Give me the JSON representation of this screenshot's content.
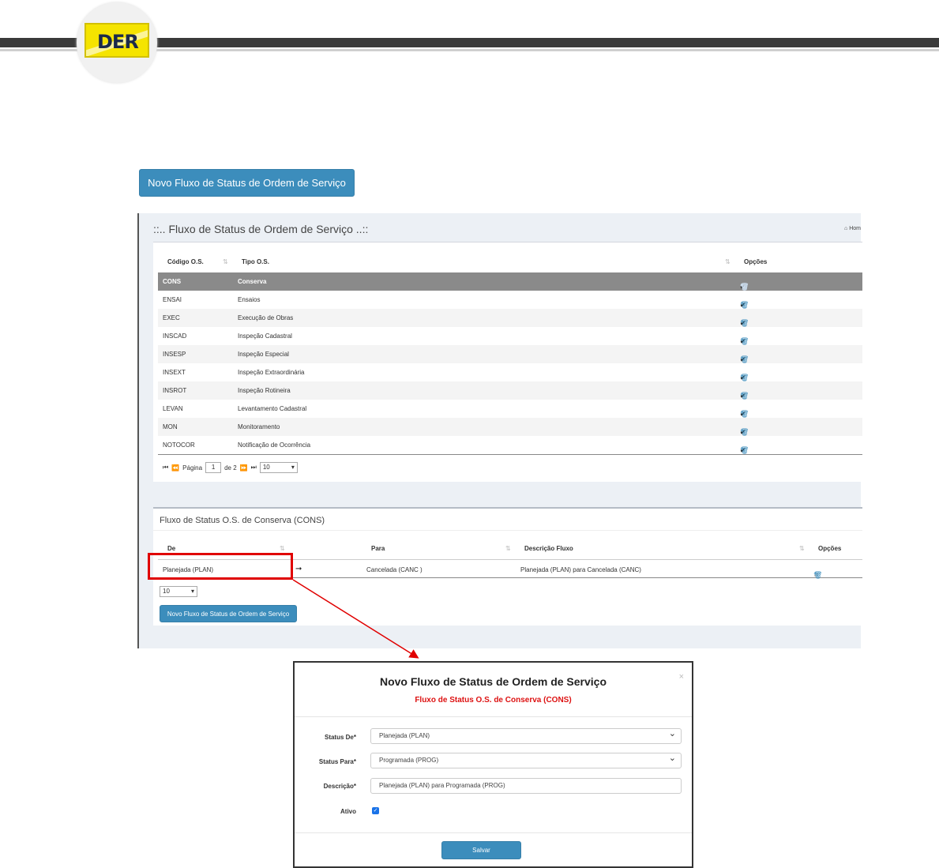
{
  "header": {
    "logo_text": "DER"
  },
  "top_button": "Novo Fluxo de Status de Ordem de Serviço",
  "panel": {
    "title": "::.. Fluxo de Status de Ordem de Serviço ..::",
    "breadcrumb": "Hom",
    "table": {
      "columns": [
        "Código O.S.",
        "Tipo O.S.",
        "Opções"
      ],
      "rows": [
        {
          "code": "CONS",
          "type": "Conserva"
        },
        {
          "code": "ENSAI",
          "type": "Ensaios"
        },
        {
          "code": "EXEC",
          "type": "Execução de Obras"
        },
        {
          "code": "INSCAD",
          "type": "Inspeção Cadastral"
        },
        {
          "code": "INSESP",
          "type": "Inspeção Especial"
        },
        {
          "code": "INSEXT",
          "type": "Inspeção Extraordinária"
        },
        {
          "code": "INSROT",
          "type": "Inspeção Rotineira"
        },
        {
          "code": "LEVAN",
          "type": "Levantamento Cadastral"
        },
        {
          "code": "MON",
          "type": "Monitoramento"
        },
        {
          "code": "NOTOCOR",
          "type": "Notificação de Ocorrência"
        }
      ],
      "selected_index": 0
    },
    "pager": {
      "label_page": "Página",
      "current": "1",
      "of": "de 2",
      "page_size": "10"
    }
  },
  "detail": {
    "title": "Fluxo de Status O.S. de Conserva (CONS)",
    "columns": [
      "De",
      "Para",
      "Descrição Fluxo",
      "Opções"
    ],
    "row": {
      "from": "Planejada (PLAN)",
      "to": "Cancelada (CANC )",
      "description": "Planejada (PLAN) para Cancelada (CANC)"
    },
    "page_size": "10",
    "button": "Novo Fluxo de Status de Ordem de Serviço"
  },
  "modal": {
    "title": "Novo Fluxo de Status de Ordem de Serviço",
    "subtitle": "Fluxo de Status O.S. de Conserva (CONS)",
    "close": "×",
    "fields": {
      "status_de_label": "Status De*",
      "status_de_value": "Planejada (PLAN)",
      "status_para_label": "Status Para*",
      "status_para_value": "Programada (PROG)",
      "descricao_label": "Descrição*",
      "descricao_value": "Planejada (PLAN) para Programada (PROG)",
      "ativo_label": "Ativo",
      "ativo_checked": true
    },
    "save": "Salvar"
  },
  "colors": {
    "primary": "#3c8dbc",
    "highlight": "#e00000",
    "subtitle": "#dd1111",
    "selected_row": "#8a8a8a"
  }
}
